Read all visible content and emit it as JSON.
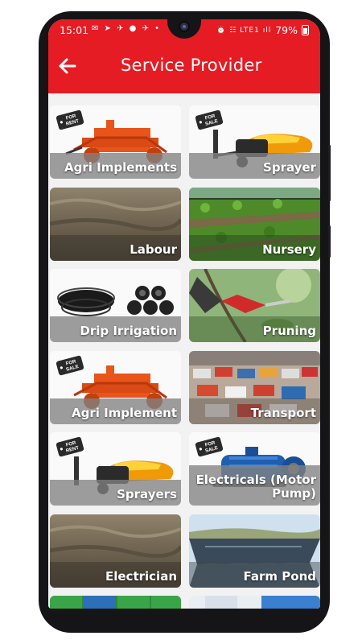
{
  "status_bar": {
    "time": "15:01",
    "left_icons": "✉ ➤ ✈ ● ✈ •",
    "right_icons": "⏰ ☷ LTE1 ıll",
    "battery": "79%"
  },
  "app_bar": {
    "title": "Service Provider",
    "back_icon": "arrow-left-icon"
  },
  "colors": {
    "primary": "#e51c24",
    "label_overlay": "#828282"
  },
  "tags": {
    "for_rent": "FOR RENT",
    "for_sale": "FOR SALE"
  },
  "services": [
    {
      "label": "Agri Implements",
      "tag": "FOR RENT",
      "image": "rotavator"
    },
    {
      "label": "Sprayer",
      "tag": "FOR SALE",
      "image": "sprayer"
    },
    {
      "label": "Labour",
      "tag": "",
      "image": "soil"
    },
    {
      "label": "Nursery",
      "tag": "",
      "image": "nursery"
    },
    {
      "label": "Drip Irrigation",
      "tag": "",
      "image": "pipes"
    },
    {
      "label": "Pruning",
      "tag": "",
      "image": "pruning"
    },
    {
      "label": "Agri Implement",
      "tag": "FOR SALE",
      "image": "rotavator"
    },
    {
      "label": "Transport",
      "tag": "",
      "image": "trucks"
    },
    {
      "label": "Sprayers",
      "tag": "FOR RENT",
      "image": "sprayer"
    },
    {
      "label": "Electricals (Motor Pump)",
      "tag": "FOR SALE",
      "image": "motor"
    },
    {
      "label": "Electrician",
      "tag": "",
      "image": "soil"
    },
    {
      "label": "Farm Pond",
      "tag": "",
      "image": "pond"
    },
    {
      "label": "",
      "tag": "",
      "image": "crates"
    },
    {
      "label": "",
      "tag": "",
      "image": "sky"
    }
  ]
}
